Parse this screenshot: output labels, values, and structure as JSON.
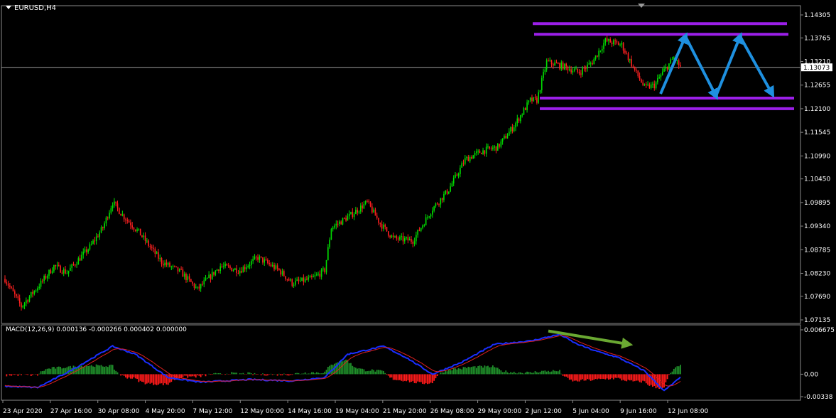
{
  "chart": {
    "symbol_title": "EURUSD,H4",
    "price_axis_labels": [
      "1.14305",
      "1.13765",
      "1.13210",
      "1.12655",
      "1.12100",
      "1.11545",
      "1.10990",
      "1.10450",
      "1.09895",
      "1.09340",
      "1.08785",
      "1.08230",
      "1.07690",
      "1.07135"
    ],
    "current_price": "1.13073",
    "macd_label": "MACD(12,26,9) 0.000136 -0.000266 0.000402 0.000000",
    "macd_axis_labels": [
      "0.006675",
      "0.00",
      "-0.00338"
    ],
    "time_axis_labels": [
      "23 Apr 2020",
      "27 Apr 16:00",
      "30 Apr 08:00",
      "4 May 20:00",
      "7 May 12:00",
      "12 May 00:00",
      "14 May 16:00",
      "19 May 04:00",
      "21 May 20:00",
      "26 May 08:00",
      "29 May 00:00",
      "2 Jun 12:00",
      "5 Jun 04:00",
      "9 Jun 16:00",
      "12 Jun 08:00"
    ]
  },
  "colors": {
    "background": "#000000",
    "bull_candle": "#00e000",
    "bear_candle": "#ff2020",
    "range_lines": "#9b1fe8",
    "projection_arrows": "#1e90e0",
    "divergence_arrow": "#6aa832",
    "macd_line": "#1a2eff",
    "signal_line": "#e02020",
    "hist_positive": "#1f8f2a",
    "hist_negative": "#ff1a1a"
  },
  "chart_data": {
    "type": "candlestick",
    "xlabel": "",
    "ylabel": "",
    "ylim": [
      1.07135,
      1.14305
    ],
    "path_keys": [
      [
        0,
        1.081
      ],
      [
        10,
        1.0745
      ],
      [
        22,
        1.08
      ],
      [
        30,
        1.084
      ],
      [
        38,
        1.0825
      ],
      [
        52,
        1.0885
      ],
      [
        60,
        1.093
      ],
      [
        66,
        1.099
      ],
      [
        72,
        1.096
      ],
      [
        82,
        1.092
      ],
      [
        96,
        1.085
      ],
      [
        108,
        1.0825
      ],
      [
        118,
        1.0785
      ],
      [
        132,
        1.084
      ],
      [
        144,
        1.083
      ],
      [
        155,
        1.086
      ],
      [
        168,
        1.083
      ],
      [
        176,
        1.08
      ],
      [
        188,
        1.081
      ],
      [
        196,
        1.083
      ],
      [
        200,
        1.093
      ],
      [
        212,
        1.096
      ],
      [
        222,
        1.099
      ],
      [
        230,
        1.094
      ],
      [
        238,
        1.0905
      ],
      [
        250,
        1.09
      ],
      [
        262,
        1.0975
      ],
      [
        272,
        1.102
      ],
      [
        282,
        1.109
      ],
      [
        292,
        1.111
      ],
      [
        302,
        1.112
      ],
      [
        312,
        1.117
      ],
      [
        322,
        1.123
      ],
      [
        326,
        1.123
      ],
      [
        332,
        1.132
      ],
      [
        342,
        1.131
      ],
      [
        352,
        1.1295
      ],
      [
        360,
        1.132
      ],
      [
        368,
        1.137
      ],
      [
        378,
        1.136
      ],
      [
        386,
        1.13
      ],
      [
        392,
        1.126
      ],
      [
        398,
        1.1265
      ],
      [
        404,
        1.13
      ],
      [
        410,
        1.133
      ],
      [
        414,
        1.1307
      ]
    ],
    "macd_path_keys": [
      [
        0,
        -0.0018
      ],
      [
        20,
        -0.002
      ],
      [
        40,
        0.0005
      ],
      [
        66,
        0.0042
      ],
      [
        80,
        0.003
      ],
      [
        100,
        -0.0005
      ],
      [
        120,
        -0.0012
      ],
      [
        150,
        -0.0008
      ],
      [
        176,
        -0.001
      ],
      [
        196,
        -0.0005
      ],
      [
        210,
        0.003
      ],
      [
        232,
        0.0042
      ],
      [
        246,
        0.0025
      ],
      [
        262,
        0.0
      ],
      [
        280,
        0.0018
      ],
      [
        300,
        0.0045
      ],
      [
        322,
        0.005
      ],
      [
        340,
        0.006
      ],
      [
        350,
        0.0046
      ],
      [
        362,
        0.0035
      ],
      [
        376,
        0.0025
      ],
      [
        392,
        0.0005
      ],
      [
        404,
        -0.0025
      ],
      [
        414,
        -0.0005
      ]
    ],
    "annotations": {
      "range_top": [
        1.141,
        1.1385
      ],
      "range_bottom": [
        1.1235,
        1.121
      ],
      "projection_path": [
        1.1245,
        1.138,
        1.124,
        1.138,
        1.1245
      ],
      "divergence_arrow": [
        0.0065,
        0.0045
      ]
    }
  }
}
